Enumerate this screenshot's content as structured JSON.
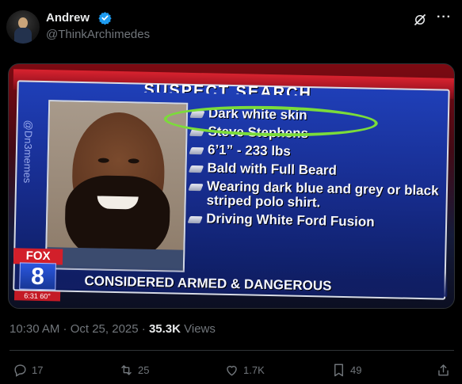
{
  "post": {
    "display_name": "Andrew",
    "handle": "@ThinkArchimedes",
    "verified": true,
    "timestamp": "10:30 AM · Oct 25, 2025 · ",
    "views_count": "35.3K",
    "views_label": " Views"
  },
  "media": {
    "title": "SUSPECT SEARCH",
    "watermark": "@Dn3memes",
    "items": [
      "Dark white skin",
      "Steve Stephens",
      "6’1” - 233 lbs",
      "Bald with Full Beard",
      "Wearing dark blue and grey or black striped polo shirt.",
      "Driving White Ford Fusion"
    ],
    "banner": "CONSIDERED ARMED & DANGEROUS",
    "logo_fox": "FOX",
    "logo_number": "8",
    "logo_time": "6:31 60°",
    "highlight_color": "#7bdc3a"
  },
  "actions": {
    "replies": "17",
    "reposts": "25",
    "likes": "1.7K",
    "bookmarks": "49"
  },
  "icons": [
    "verified-badge-icon",
    "grok-icon",
    "more-icon",
    "reply-icon",
    "repost-icon",
    "like-icon",
    "bookmark-icon",
    "share-icon"
  ],
  "colors": {
    "accent": "#1d9bf0",
    "muted": "#71767b",
    "text": "#e7e9ea",
    "background": "#000000"
  }
}
